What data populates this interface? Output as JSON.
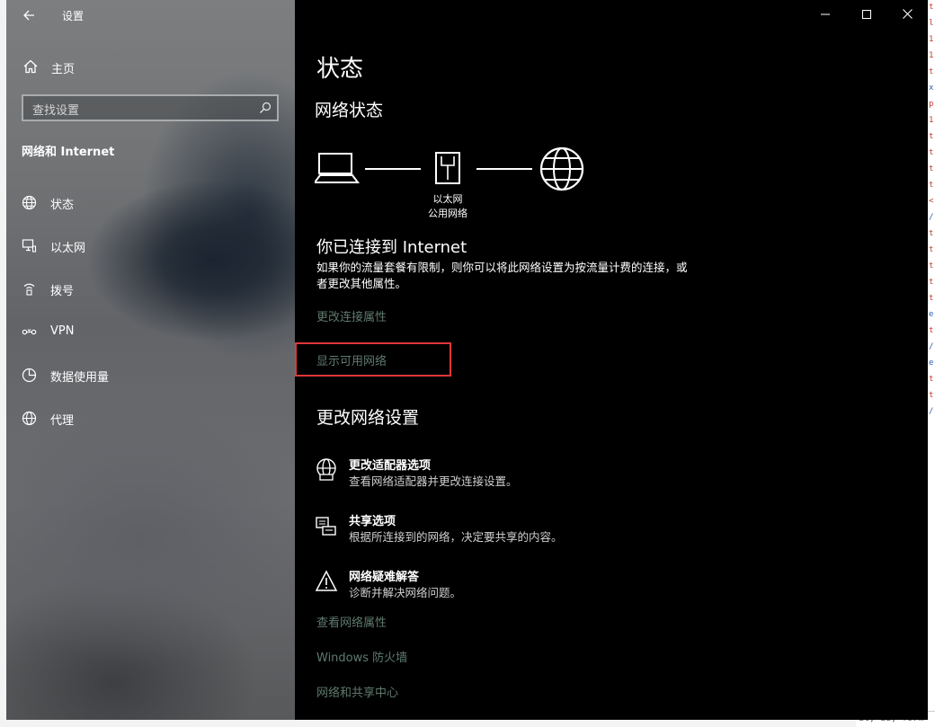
{
  "window": {
    "title": "设置"
  },
  "sidebar": {
    "home_label": "主页",
    "search_placeholder": "查找设置",
    "section_title": "网络和 Internet",
    "items": [
      {
        "label": "状态",
        "icon": "globe-status-icon"
      },
      {
        "label": "以太网",
        "icon": "ethernet-monitor-icon"
      },
      {
        "label": "拨号",
        "icon": "dialup-phone-icon"
      },
      {
        "label": "VPN",
        "icon": "vpn-icon"
      },
      {
        "label": "数据使用量",
        "icon": "data-usage-icon"
      },
      {
        "label": "代理",
        "icon": "globe-proxy-icon"
      }
    ]
  },
  "content": {
    "page_title": "状态",
    "network_status_title": "网络状态",
    "diagram": {
      "adapter_name": "以太网",
      "network_type": "公用网络"
    },
    "connected_title": "你已连接到 Internet",
    "connected_desc": "如果你的流量套餐有限制，则你可以将此网络设置为按流量计费的连接，或者更改其他属性。",
    "change_connection_props": "更改连接属性",
    "show_available_networks": "显示可用网络",
    "change_settings_title": "更改网络设置",
    "options": [
      {
        "title": "更改适配器选项",
        "desc": "查看网络适配器并更改连接设置。"
      },
      {
        "title": "共享选项",
        "desc": "根据所连接到的网络，决定要共享的内容。"
      },
      {
        "title": "网络疑难解答",
        "desc": "诊断并解决网络问题。"
      }
    ],
    "links": {
      "view_network_props": "查看网络属性",
      "firewall": "Windows 防火墙",
      "sharing_center": "网络和共享中心"
    }
  },
  "colors": {
    "accent_link": "#5e7a6e",
    "highlight_border": "#e0373a",
    "content_bg": "#000000"
  }
}
